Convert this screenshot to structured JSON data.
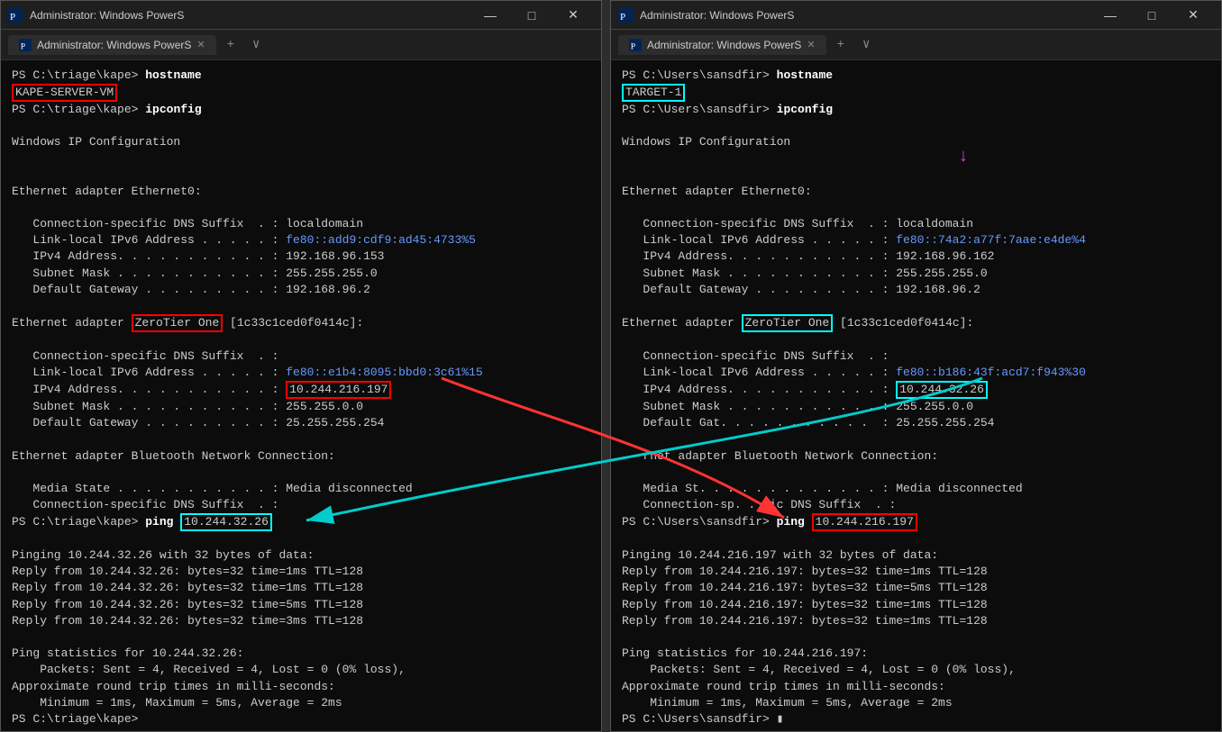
{
  "left_terminal": {
    "title": "Administrator: Windows PowerS",
    "content_lines": [
      {
        "type": "prompt",
        "text": "PS C:\\triage\\kape> ",
        "cmd": "hostname"
      },
      {
        "type": "output",
        "text": "KAPE-SERVER-VM",
        "highlight": "red"
      },
      {
        "type": "prompt",
        "text": "PS C:\\triage\\kape> ",
        "cmd": "ipconfig"
      },
      {
        "type": "blank"
      },
      {
        "type": "output",
        "text": "Windows IP Configuration"
      },
      {
        "type": "blank"
      },
      {
        "type": "blank"
      },
      {
        "type": "output",
        "text": "Ethernet adapter Ethernet0:"
      },
      {
        "type": "blank"
      },
      {
        "type": "output",
        "text": "   Connection-specific DNS Suffix  . : localdomain"
      },
      {
        "type": "output",
        "text": "   Link-local IPv6 Address . . . . . : fe80::add9:cdf9:ad45:4733%5",
        "ipv6": true
      },
      {
        "type": "output",
        "text": "   IPv4 Address. . . . . . . . . . . : 192.168.96.153"
      },
      {
        "type": "output",
        "text": "   Subnet Mask . . . . . . . . . . . : 255.255.255.0"
      },
      {
        "type": "output",
        "text": "   Default Gateway . . . . . . . . . : 192.168.96.2"
      },
      {
        "type": "blank"
      },
      {
        "type": "output_zerotier",
        "prefix": "Ethernet adapter ",
        "zt": "ZeroTier One",
        "suffix": " [1c33c1ced0f0414c]:"
      },
      {
        "type": "blank"
      },
      {
        "type": "output",
        "text": "   Connection-specific DNS Suffix  . :"
      },
      {
        "type": "output",
        "text": "   Link-local IPv6 Address . . . . . : fe80::e1b4:8095:bbd0:3c61%15",
        "ipv6": true
      },
      {
        "type": "output_ip",
        "prefix": "   IPv4 Address. . . . . . . . . . . : ",
        "ip": "10.244.216.197",
        "highlight": "red"
      },
      {
        "type": "output",
        "text": "   Subnet Mask . . . . . . . . . . . : 255.255.0.0"
      },
      {
        "type": "output",
        "text": "   Default Gateway . . . . . . . . . : 25.255.255.254"
      },
      {
        "type": "blank"
      },
      {
        "type": "output",
        "text": "Ethernet adapter Bluetooth Network Connection:"
      },
      {
        "type": "blank"
      },
      {
        "type": "output",
        "text": "   Media State . . . . . . . . . . . : Media disconnected"
      },
      {
        "type": "output",
        "text": "   Connection-specific DNS Suffix  . :"
      },
      {
        "type": "prompt_ping",
        "text": "PS C:\\triage\\kape> ",
        "cmd": "ping ",
        "ip": "10.244.32.26",
        "highlight": "cyan"
      },
      {
        "type": "blank"
      },
      {
        "type": "output",
        "text": "Pinging 10.244.32.26 with 32 bytes of data:"
      },
      {
        "type": "output",
        "text": "Reply from 10.244.32.26: bytes=32 time=1ms TTL=128"
      },
      {
        "type": "output",
        "text": "Reply from 10.244.32.26: bytes=32 time=1ms TTL=128"
      },
      {
        "type": "output",
        "text": "Reply from 10.244.32.26: bytes=32 time=5ms TTL=128"
      },
      {
        "type": "output",
        "text": "Reply from 10.244.32.26: bytes=32 time=3ms TTL=128"
      },
      {
        "type": "blank"
      },
      {
        "type": "output",
        "text": "Ping statistics for 10.244.32.26:"
      },
      {
        "type": "output",
        "text": "    Packets: Sent = 4, Received = 4, Lost = 0 (0% loss),"
      },
      {
        "type": "output",
        "text": "Approximate round trip times in milli-seconds:"
      },
      {
        "type": "output",
        "text": "    Minimum = 1ms, Maximum = 5ms, Average = 2ms"
      },
      {
        "type": "prompt_end",
        "text": "PS C:\\triage\\kape> "
      }
    ]
  },
  "right_terminal": {
    "title": "Administrator: Windows PowerS",
    "content_lines": [
      {
        "type": "prompt",
        "text": "PS C:\\Users\\sansdfir> ",
        "cmd": "hostname"
      },
      {
        "type": "output",
        "text": "TARGET-1",
        "highlight": "cyan"
      },
      {
        "type": "prompt",
        "text": "PS C:\\Users\\sansdfir> ",
        "cmd": "ipconfig"
      },
      {
        "type": "blank"
      },
      {
        "type": "output",
        "text": "Windows IP Configuration"
      },
      {
        "type": "blank"
      },
      {
        "type": "blank"
      },
      {
        "type": "output",
        "text": "Ethernet adapter Ethernet0:"
      },
      {
        "type": "blank"
      },
      {
        "type": "output",
        "text": "   Connection-specific DNS Suffix  . : localdomain"
      },
      {
        "type": "output",
        "text": "   Link-local IPv6 Address . . . . . : fe80::74a2:a77f:7aae:e4de%4",
        "ipv6": true
      },
      {
        "type": "output",
        "text": "   IPv4 Address. . . . . . . . . . . : 192.168.96.162"
      },
      {
        "type": "output",
        "text": "   Subnet Mask . . . . . . . . . . . : 255.255.255.0"
      },
      {
        "type": "output",
        "text": "   Default Gateway . . . . . . . . . : 192.168.96.2"
      },
      {
        "type": "blank"
      },
      {
        "type": "output_zerotier",
        "prefix": "Ethernet adapter ",
        "zt": "ZeroTier One",
        "suffix": " [1c33c1ced0f0414c]:"
      },
      {
        "type": "blank"
      },
      {
        "type": "output",
        "text": "   Connection-specific DNS Suffix  . :"
      },
      {
        "type": "output",
        "text": "   Link-local IPv6 Address . . . . . : fe80::b186:43f:acd7:f943%30",
        "ipv6": true
      },
      {
        "type": "output_ip",
        "prefix": "   IPv4 Address. . . . . . . . . . . : ",
        "ip": "10.244.32.26",
        "highlight": "cyan"
      },
      {
        "type": "output",
        "text": "   Subnet Mask . . . . . . . . . . . : 255.255.0.0"
      },
      {
        "type": "output",
        "text": "   Default Gat. . . . . . . . . . .  : 25.255.255.254"
      },
      {
        "type": "blank"
      },
      {
        "type": "output",
        "text": "   rnet adapter Bluetooth Network Connection:"
      },
      {
        "type": "blank"
      },
      {
        "type": "output",
        "text": "   Media St. . . . . . . . . . . . . : Media disconnected"
      },
      {
        "type": "output",
        "text": "   Connection-sp. . fic DNS Suffix  . :"
      },
      {
        "type": "prompt_ping",
        "text": "PS C:\\Users\\sansdfir> ",
        "cmd": "ping ",
        "ip": "10.244.216.197",
        "highlight": "red"
      },
      {
        "type": "blank"
      },
      {
        "type": "output",
        "text": "Pinging 10.244.216.197 with 32 bytes of data:"
      },
      {
        "type": "output",
        "text": "Reply from 10.244.216.197: bytes=32 time=1ms TTL=128"
      },
      {
        "type": "output",
        "text": "Reply from 10.244.216.197: bytes=32 time=5ms TTL=128"
      },
      {
        "type": "output",
        "text": "Reply from 10.244.216.197: bytes=32 time=1ms TTL=128"
      },
      {
        "type": "output",
        "text": "Reply from 10.244.216.197: bytes=32 time=1ms TTL=128"
      },
      {
        "type": "blank"
      },
      {
        "type": "output",
        "text": "Ping statistics for 10.244.216.197:"
      },
      {
        "type": "output",
        "text": "    Packets: Sent = 4, Received = 4, Lost = 0 (0% loss),"
      },
      {
        "type": "output",
        "text": "Approximate round trip times in milli-seconds:"
      },
      {
        "type": "output",
        "text": "    Minimum = 1ms, Maximum = 5ms, Average = 2ms"
      },
      {
        "type": "prompt_end",
        "text": "PS C:\\Users\\sansdfir> "
      }
    ]
  },
  "ui": {
    "tab_label": "Administrator: Windows PowerS",
    "btn_minimize": "—",
    "btn_maximize": "□",
    "btn_close": "✕",
    "btn_new_tab": "+",
    "btn_chevron": "∨"
  },
  "arrows": {
    "red_arrow": {
      "desc": "Red arrow from left terminal IP to right terminal ping",
      "color": "#ff3333"
    },
    "cyan_arrow": {
      "desc": "Cyan arrow from right terminal IP to left terminal ping",
      "color": "#00cccc"
    }
  }
}
